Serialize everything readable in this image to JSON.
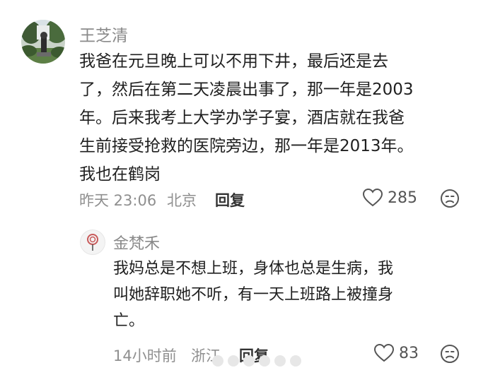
{
  "comment": {
    "username": "王芝清",
    "lines": [
      "我爸在元旦晚上可以不用下井，最后还是去",
      "了，然后在第二天凌晨出事了，那一年是2003",
      "年。后来我考上大学办学子宴，酒店就在我爸",
      "生前接受抢救的医院旁边，那一年是2013年。",
      "我也在鹤岗"
    ],
    "time": "昨天 23:06",
    "location": "北京",
    "reply_label": "回复",
    "like_count": "285",
    "avatar_icon": "avatar-photo-icon"
  },
  "reply": {
    "username": "金梵禾",
    "lines": [
      "我妈总是不想上班，身体也总是生病，我",
      "叫她辞职她不听，有一天上班路上被撞身",
      "亡。"
    ],
    "time": "14小时前",
    "location": "浙江",
    "reply_label": "回复",
    "like_count": "83",
    "avatar_icon": "avatar-lollipop-icon"
  },
  "colors": {
    "text": "#1f1f1f",
    "meta": "#8f8f8f",
    "username": "#8a8a8a"
  }
}
